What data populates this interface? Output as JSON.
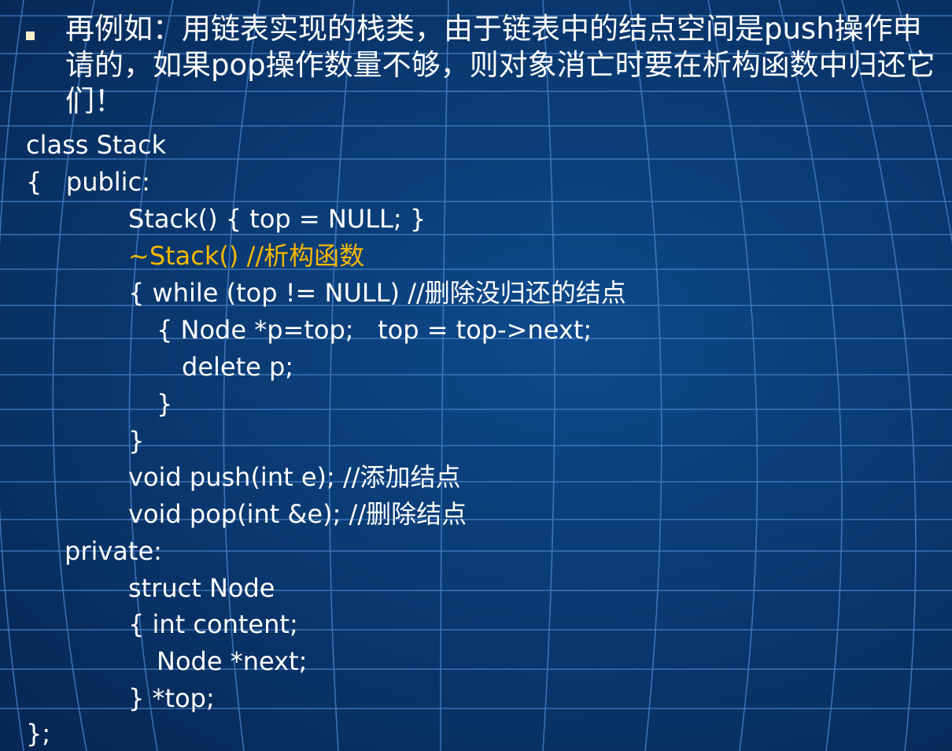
{
  "slide": {
    "bullet_text": "再例如：用链表实现的栈类，由于链表中的结点空间是push操作申请的，如果pop操作数量不够，则对象消亡时要在析构函数中归还它们！",
    "code_lines": [
      "class Stack",
      "{   public:",
      "Stack() { top = NULL; }",
      "~Stack() //析构函数",
      "{ while (top != NULL) //删除没归还的结点",
      "{ Node *p=top;   top = top->next;",
      "delete p;",
      "}",
      "}",
      "void push(int e); //添加结点",
      "void pop(int &e); //删除结点",
      "private:",
      "struct Node",
      "{ int content;",
      "Node *next;",
      "} *top;",
      "};"
    ]
  },
  "colors": {
    "background": "#0a3a72",
    "text": "#ffffff",
    "highlight": "#f5b800",
    "bullet": "#f2efc9",
    "grid": "#3f7fc8"
  }
}
